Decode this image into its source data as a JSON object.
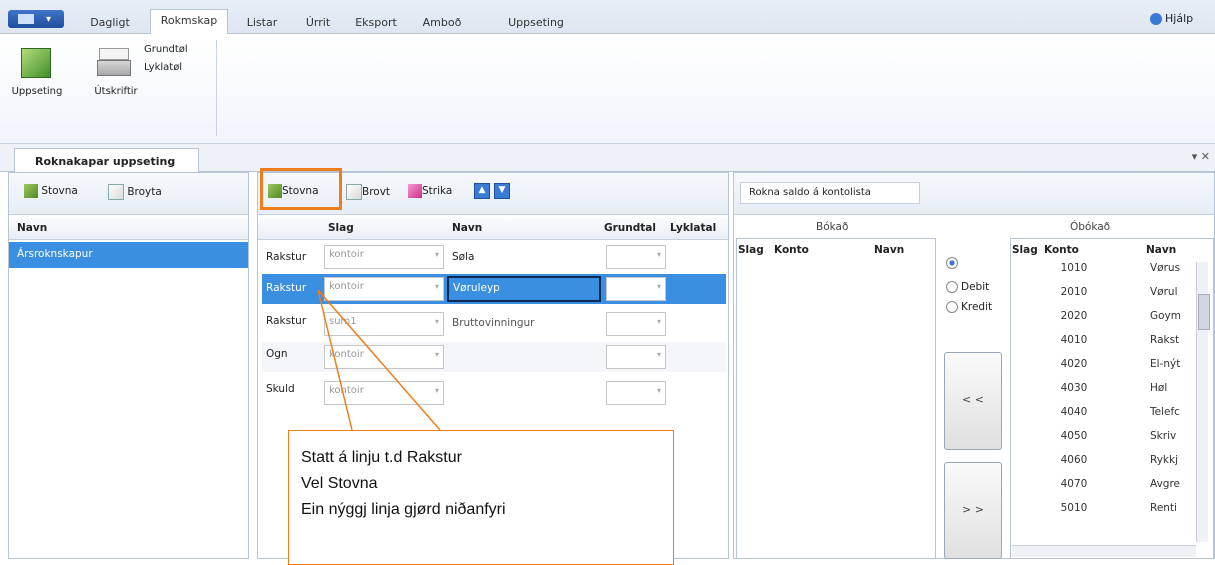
{
  "menubar": {
    "tabs": [
      "Dagligt",
      "Rokmskap",
      "Listar",
      "Úrrit",
      "Eksport",
      "Amboð",
      "Uppseting"
    ],
    "help_label": "Hjálp"
  },
  "ribbon": {
    "uppseting_label": "Uppseting",
    "utskriftir_label": "Útskriftir",
    "grundtal_label": "Grundtøl",
    "lyklatal_label": "Lyklatøl"
  },
  "doc_tab": {
    "title": "Roknakapar uppseting",
    "pin": "▾ ✕"
  },
  "left_panel": {
    "add_label": "Stovna",
    "edit_label": "Broyta",
    "column": "Navn",
    "items": [
      "Ársroknskapur"
    ]
  },
  "mid_panel": {
    "add_label": "Stovna",
    "edit_label": "Brovt",
    "delete_label": "Strika",
    "columns": [
      "Slag",
      "Navn",
      "Grundtal",
      "Lyklatal"
    ],
    "rows": [
      {
        "type": "Rakstur",
        "slag": "kontoir",
        "navn": "Søla"
      },
      {
        "type": "Rakstur",
        "slag": "kontoir",
        "navn": "Vøruleyp"
      },
      {
        "type": "Rakstur",
        "slag": "sum1",
        "navn": "Bruttovinningur"
      },
      {
        "type": "Ogn",
        "slag": "kontoir",
        "navn": ""
      },
      {
        "type": "Skuld",
        "slag": "kontoir",
        "navn": ""
      }
    ]
  },
  "right_panel": {
    "rokna_label": "Rokna saldo á kontolista",
    "bokad_title": "Bókað",
    "obokad_title": "Óbókað",
    "bokad_columns": [
      "Slag",
      "Konto",
      "Navn"
    ],
    "obokad_columns": [
      "Slag",
      "Konto",
      "Navn"
    ],
    "debit_label": "Debit",
    "kredit_label": "Kredit",
    "move_left": "< <",
    "move_right": "> >",
    "obokad_rows": [
      {
        "konto": "1010",
        "navn": "Vørus"
      },
      {
        "konto": "2010",
        "navn": "Vørul"
      },
      {
        "konto": "2020",
        "navn": "Goym"
      },
      {
        "konto": "4010",
        "navn": "Rakst"
      },
      {
        "konto": "4020",
        "navn": "El-nýt"
      },
      {
        "konto": "4030",
        "navn": "Høl"
      },
      {
        "konto": "4040",
        "navn": "Telefc"
      },
      {
        "konto": "4050",
        "navn": "Skriv"
      },
      {
        "konto": "4060",
        "navn": "Rykkj"
      },
      {
        "konto": "4070",
        "navn": "Avgre"
      },
      {
        "konto": "5010",
        "navn": "Renti"
      }
    ]
  },
  "callout": {
    "line1": "Statt á linju t.d Rakstur",
    "line2": "Vel Stovna",
    "line3": "Ein nýggj linja gjørd niðanfyri"
  },
  "colors": {
    "highlight": "#f07d1c",
    "selection": "#3a8fe0"
  }
}
